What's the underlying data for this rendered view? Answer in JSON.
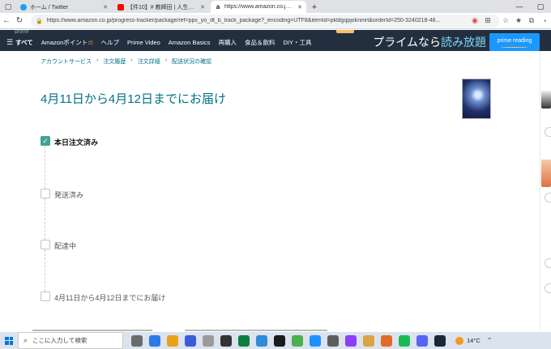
{
  "browser": {
    "tabs": [
      {
        "title": "ホーム / Twitter",
        "favicon_color": "#1da1f2",
        "active": false
      },
      {
        "title": "【件10】# 教師田 | 人生で最も影響",
        "favicon_color": "#ff0000",
        "active": false
      },
      {
        "title": "https://www.amazon.co.jp/progr",
        "favicon_color": "#111111",
        "active": true
      }
    ],
    "new_tab": "+",
    "url": "https://www.amazon.co.jp/progress-tracker/package/ref=ppx_yo_dt_b_track_package?_encoding=UTF8&itemId=pkldgqpjoknmrt&orderId=250-3240218-48..."
  },
  "amazon": {
    "logo_fragment": "prime",
    "nav": {
      "all": "すべて",
      "points_label": "Amazonポイント:",
      "points_value": "0",
      "items": [
        "ヘルプ",
        "Prime Video",
        "Amazon Basics",
        "再購入",
        "食品＆飲料",
        "DIY・工具"
      ]
    },
    "prime_banner": {
      "prefix": "プライムなら",
      "highlight": "読み放題"
    },
    "prime_reading": "prime reading"
  },
  "breadcrumb": [
    "アカウントサービス",
    "注文履歴",
    "注文詳細",
    "配送状況の確認"
  ],
  "delivery_heading": "4月11日から4月12日までにお届け",
  "timeline": [
    {
      "label": "本日注文済み",
      "done": true
    },
    {
      "label": "発送済み",
      "done": false
    },
    {
      "label": "配達中",
      "done": false
    },
    {
      "label": "4月11日から4月12日までにお届け",
      "done": false
    }
  ],
  "taskbar": {
    "search_placeholder": "ここに入力して検索",
    "weather": "14°C",
    "app_colors": [
      "#6b6b6b",
      "#2a7be4",
      "#e8a317",
      "#3b5bdb",
      "#9b9b9b",
      "#333333",
      "#0f7b3e",
      "#2e8bd8",
      "#1b1b1b",
      "#4caf50",
      "#1e90ff",
      "#5d5d5d",
      "#8a3ffc",
      "#d9a441",
      "#e26b2a",
      "#1db954",
      "#5865f2",
      "#1b2838"
    ]
  }
}
